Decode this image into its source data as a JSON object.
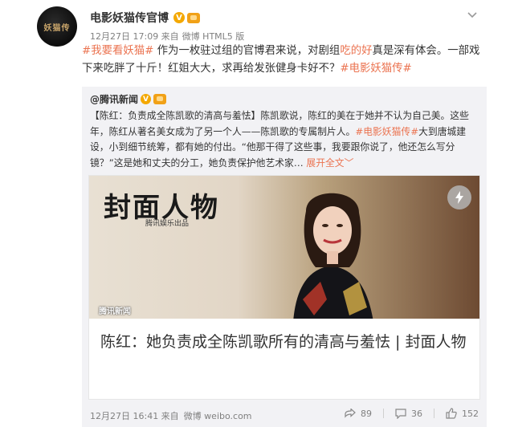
{
  "post": {
    "author": "电影妖猫传官博",
    "verified": "V",
    "meta": {
      "time": "12月27日 17:09 来自",
      "source": "微博 HTML5 版"
    },
    "text_parts": {
      "topic1": "#我要看妖猫#",
      "t1": " 作为一枚驻过组的官博君来说，对剧组",
      "hl": "吃的好",
      "t2": "真是深有体会。一部戏下来吃胖了十斤！红姐大大，求再给发张健身卡好不？",
      "topic2": "#电影妖猫传#"
    },
    "chevron_icon": "chevron-down-icon"
  },
  "repost": {
    "author": "@腾讯新闻",
    "verified": "V",
    "text_parts": {
      "a": "【陈红：负责成全陈凯歌的清高与羞怯】陈凯歌说，陈红的美在于她并不认为自己美。这些年，陈红从著名美女成为了另一个人——陈凯歌的专属制片人。",
      "topic": "#电影妖猫传#",
      "b": "大到唐城建设，小到细节统筹，都有她的付出。“他那干得了这些事，我要跟你说了，他还怎么写分镜？”这是她和丈夫的分工，她负责保护他艺术家… ",
      "expand": "展开全文",
      "expand_arrow": "﹀"
    },
    "card": {
      "cover_title": "封面人物",
      "cover_sub": "腾讯娱乐出品",
      "cover_credit": "腾讯新闻",
      "title": "陈红：她负责成全陈凯歌所有的清高与羞怯 | 封面人物"
    },
    "footer": {
      "time": "12月27日 16:41 来自",
      "source": "微博 weibo.com",
      "repost_count": "89",
      "comment_count": "36",
      "like_count": "152"
    }
  },
  "colors": {
    "accent": "#eb7350",
    "text": "#333333",
    "meta": "#808080",
    "repost_bg": "#f2f2f5"
  },
  "avatar_text": "妖猫传"
}
